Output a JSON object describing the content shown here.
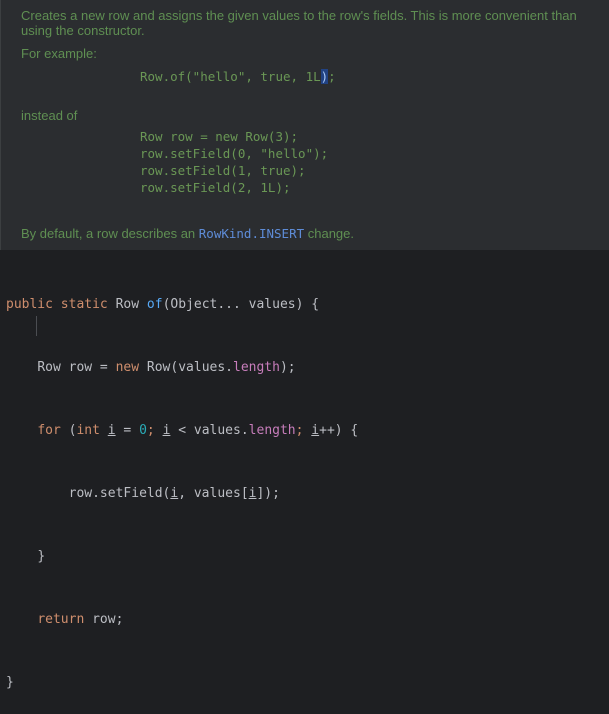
{
  "doc": {
    "line1": "Creates a new row and assigns the given values to the row's fields. This is more convenient than",
    "line2": "using the constructor.",
    "example_label": "For example:",
    "example_code_before": "Row.of(\"hello\", true, 1L",
    "example_code_caret": ")",
    "example_code_after": ";",
    "instead_label": "instead of",
    "instead_code": [
      "Row row = new Row(3);",
      "row.setField(0, \"hello\");",
      "row.setField(1, true);",
      "row.setField(2, 1L);"
    ],
    "default_before": "By default, a row describes an ",
    "default_link": "RowKind.INSERT",
    "default_after": " change."
  },
  "code": {
    "kw_public": "public",
    "kw_static": "static",
    "ret_type": "Row",
    "method_name": "of",
    "params": "(Object... values) {",
    "l2_decl": "Row row = ",
    "kw_new": "new",
    "l2_ctor": " Row(values.",
    "l2_field": "length",
    "l2_end": ");",
    "kw_for": "for",
    "l3_open": " (",
    "kw_int": "int",
    "var_i": "i",
    "l3_eq": " = ",
    "num_0": "0",
    "l3_semi": "; ",
    "l3_lt": " < values.",
    "l3_field": "length",
    "l3_semi2": "; ",
    "l3_inc": "++) {",
    "l4_call": "row.setField(",
    "l4_mid": ", values[",
    "l4_end": "]);",
    "close_brace": "}",
    "kw_return": "return",
    "l6_ret": " row;",
    "method_close": "}"
  }
}
